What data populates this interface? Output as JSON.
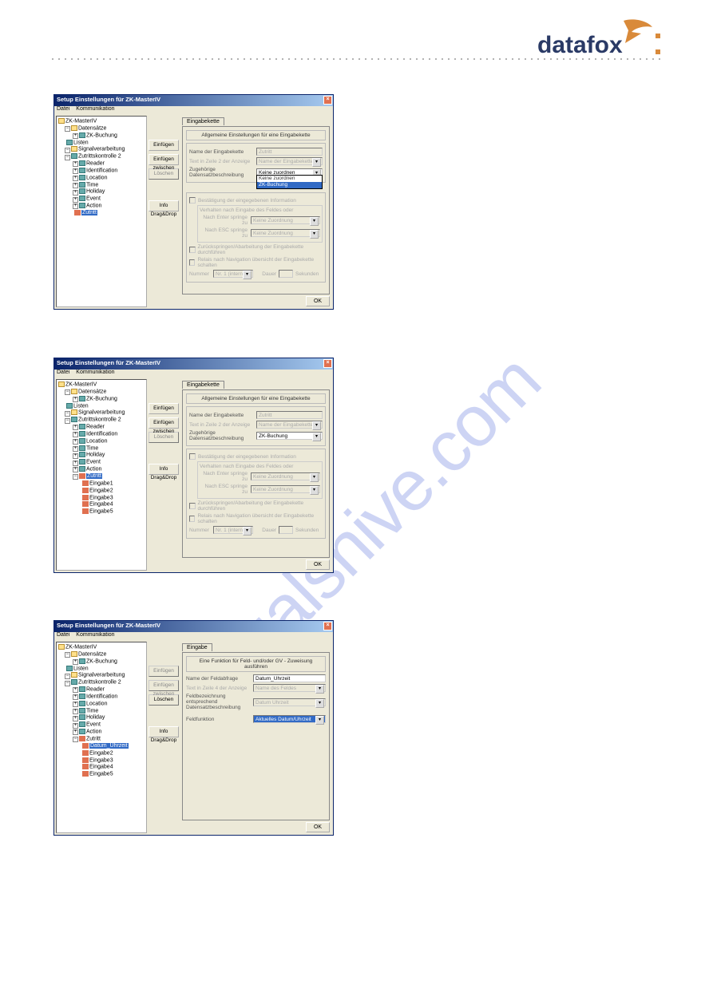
{
  "watermark": "manualshive.com",
  "logo_text": "datafox",
  "win_title": "Setup Einstellungen für ZK-MasterIV",
  "menu": {
    "file": "Datei",
    "comm": "Kommunikation"
  },
  "sidebtns": {
    "insert": "Einfügen",
    "insert_between": "Einfügen zwischen",
    "delete": "Löschen",
    "info": "Info Drag&Drop"
  },
  "tree_common": {
    "root": "ZK-MasterIV",
    "datensatze": "Datensätze",
    "zkbuchung": "ZK-Buchung",
    "listen": "Listen",
    "signal": "Signalverarbeitung",
    "zutritt2": "Zutrittskontrolle 2",
    "reader": "Reader",
    "ident": "Identification",
    "location": "Location",
    "time": "Time",
    "holiday": "Holiday",
    "event": "Event",
    "action": "Action",
    "zutritt": "Zutritt"
  },
  "tree2_extra": [
    "Eingabe1",
    "Eingabe2",
    "Eingabe3",
    "Eingabe4",
    "Eingabe5"
  ],
  "tree3_extra": [
    "Datum_Uhrzeit",
    "Eingabe2",
    "Eingabe3",
    "Eingabe4",
    "Eingabe5"
  ],
  "panel1": {
    "tab": "Eingabekette",
    "group_title": "Allgemeine Einstellungen für eine Eingabekette",
    "name_label": "Name der Eingabekette",
    "name_value": "Zutritt",
    "text2_label": "Text in Zeile 2 der Anzeige",
    "text2_value": "Name der Eingabekette",
    "zugeh_label": "Zugehörige Datensatzbeschreibung",
    "dd_visible": "Keine zuordnen",
    "dd_opt1": "Keine zuordnen",
    "dd_opt2": "ZK-Buchung",
    "chk1": "Bestätigung der eingegebenen Information",
    "sub_label": "Verhalten nach Eingabe des Feldes oder",
    "nach_enter": "Nach Enter springe zu",
    "nach_esc": "Nach ESC springe zu",
    "keine": "Keine Zuordnung",
    "chk2": "Zurückspringen/Abarbeitung der Eingabekette durchführen",
    "chk3": "Relais nach Navigation übersicht der Eingabekette schalten",
    "nummer": "Nummer",
    "nr_val": "Nr. 1 (intern)",
    "dauer": "Dauer",
    "sek": "Sekunden"
  },
  "panel2": {
    "tab": "Eingabekette",
    "group_title": "Allgemeine Einstellungen für eine Eingabekette",
    "name_label": "Name der Eingabekette",
    "name_value": "Zutritt",
    "text2_label": "Text in Zeile 2 der Anzeige",
    "text2_value": "Name der Eingabekette",
    "zugeh_label": "Zugehörige Datensatzbeschreibung",
    "dd_value": "ZK-Buchung",
    "chk1": "Bestätigung der eingegebenen Information",
    "sub_label": "Verhalten nach Eingabe des Feldes oder",
    "nach_enter": "Nach Enter springe zu",
    "nach_esc": "Nach ESC springe zu",
    "keine": "Keine Zuordnung",
    "chk2": "Zurückspringen/Abarbeitung der Eingabekette durchführen",
    "chk3": "Relais nach Navigation übersicht der Eingabekette schalten",
    "nummer": "Nummer",
    "nr_val": "Nr. 1 (intern)",
    "dauer": "Dauer",
    "sek": "Sekunden"
  },
  "panel3": {
    "tab": "Eingabe",
    "group_title": "Eine Funktion für Feld- und/oder GV - Zuweisung ausführen",
    "name_label": "Name der Feldabfrage",
    "name_value": "Datum_Uhrzeit",
    "text2_label": "Text in Zeile 4 der Anzeige",
    "text2_value": "Name des Feldes",
    "feldbez_label": "Feldbezeichnung entsprechend Datensatzbeschreibung",
    "feldbez_value": "Datum Uhrzeit",
    "feldfkt_label": "Feldfunktion",
    "feldfkt_value": "Aktuelles Datum/Uhrzeit"
  },
  "ok": "OK"
}
